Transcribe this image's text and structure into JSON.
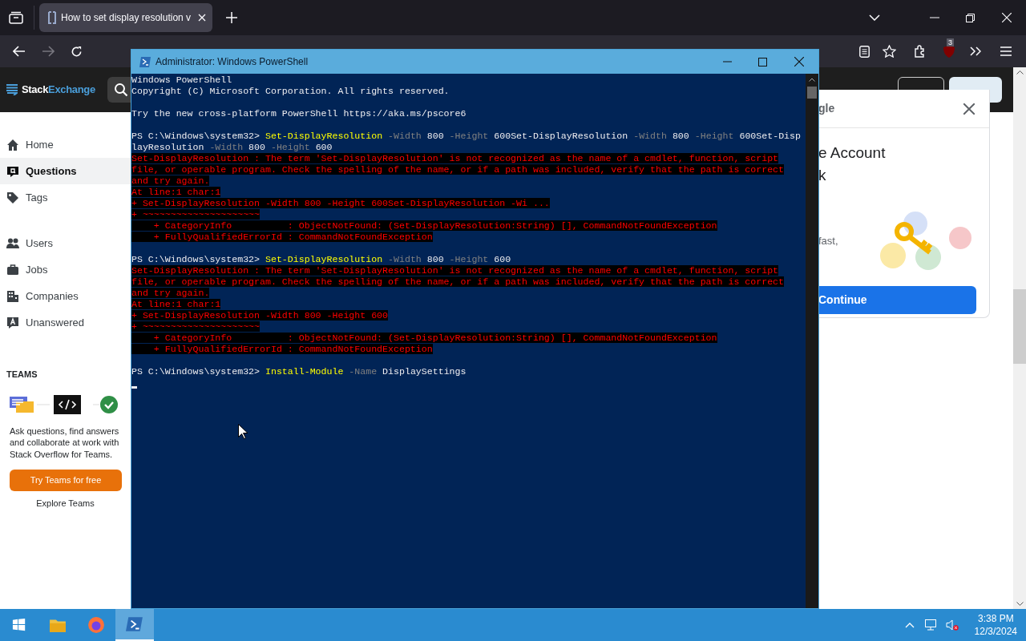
{
  "browser": {
    "tab": {
      "title": "How to set display resolution v",
      "selected": true
    },
    "extension_badge": "3"
  },
  "site": {
    "logo": {
      "first": "Stack",
      "second": "Exchange"
    },
    "nav_groups": [
      [
        {
          "label": "Home",
          "selected": false
        },
        {
          "label": "Questions",
          "selected": true
        },
        {
          "label": "Tags",
          "selected": false
        }
      ],
      [
        {
          "label": "Users",
          "selected": false
        },
        {
          "label": "Jobs",
          "selected": false
        },
        {
          "label": "Companies",
          "selected": false
        },
        {
          "label": "Unanswered",
          "selected": false
        }
      ]
    ],
    "teams": {
      "heading": "TEAMS",
      "description": "Ask questions, find answers and collaborate at work with Stack Overflow for Teams.",
      "button": "Try Teams for free",
      "link": "Explore Teams"
    }
  },
  "popup": {
    "title": "gle",
    "heading_lines": [
      "e Account",
      "k"
    ],
    "text": "fast,",
    "button": "Continue"
  },
  "powershell": {
    "title": "Administrator: Windows PowerShell",
    "lines": [
      {
        "kind": "text",
        "segments": [
          {
            "kind": "plain",
            "text": "Windows PowerShell"
          }
        ]
      },
      {
        "kind": "text",
        "segments": [
          {
            "kind": "plain",
            "text": "Copyright (C) Microsoft Corporation. All rights reserved."
          }
        ]
      },
      {
        "kind": "blank"
      },
      {
        "kind": "text",
        "segments": [
          {
            "kind": "plain",
            "text": "Try the new cross-platform PowerShell https://aka.ms/pscore6"
          }
        ]
      },
      {
        "kind": "blank"
      },
      {
        "kind": "text",
        "segments": [
          {
            "kind": "plain",
            "text": "PS C:\\Windows\\system32> "
          },
          {
            "kind": "command",
            "text": "Set-DisplayResolution"
          },
          {
            "kind": "parameter",
            "text": " -Width"
          },
          {
            "kind": "plain",
            "text": " 800"
          },
          {
            "kind": "parameter",
            "text": " -Height"
          },
          {
            "kind": "plain",
            "text": " 600Set-DisplayResolution"
          },
          {
            "kind": "parameter",
            "text": " -Width"
          },
          {
            "kind": "plain",
            "text": " 800"
          },
          {
            "kind": "parameter",
            "text": " -Height"
          },
          {
            "kind": "plain",
            "text": " 600Set-Disp"
          }
        ]
      },
      {
        "kind": "text",
        "segments": [
          {
            "kind": "plain",
            "text": "layResolution"
          },
          {
            "kind": "parameter",
            "text": " -Width"
          },
          {
            "kind": "plain",
            "text": " 800"
          },
          {
            "kind": "parameter",
            "text": " -Height"
          },
          {
            "kind": "plain",
            "text": " 600"
          }
        ]
      },
      {
        "kind": "error",
        "text": "Set-DisplayResolution : The term 'Set-DisplayResolution' is not recognized as the name of a cmdlet, function, script"
      },
      {
        "kind": "error",
        "text": "file, or operable program. Check the spelling of the name, or if a path was included, verify that the path is correct"
      },
      {
        "kind": "error",
        "text": "and try again."
      },
      {
        "kind": "error",
        "text": "At line:1 char:1"
      },
      {
        "kind": "error",
        "text": "+ Set-DisplayResolution -Width 800 -Height 600Set-DisplayResolution -Wi ..."
      },
      {
        "kind": "error",
        "text": "+ ~~~~~~~~~~~~~~~~~~~~~"
      },
      {
        "kind": "error",
        "text": "    + CategoryInfo          : ObjectNotFound: (Set-DisplayResolution:String) [], CommandNotFoundException"
      },
      {
        "kind": "error",
        "text": "    + FullyQualifiedErrorId : CommandNotFoundException"
      },
      {
        "kind": "blank"
      },
      {
        "kind": "text",
        "segments": [
          {
            "kind": "plain",
            "text": "PS C:\\Windows\\system32> "
          },
          {
            "kind": "command",
            "text": "Set-DisplayResolution"
          },
          {
            "kind": "parameter",
            "text": " -Width"
          },
          {
            "kind": "plain",
            "text": " 800"
          },
          {
            "kind": "parameter",
            "text": " -Height"
          },
          {
            "kind": "plain",
            "text": " 600"
          }
        ]
      },
      {
        "kind": "error",
        "text": "Set-DisplayResolution : The term 'Set-DisplayResolution' is not recognized as the name of a cmdlet, function, script"
      },
      {
        "kind": "error",
        "text": "file, or operable program. Check the spelling of the name, or if a path was included, verify that the path is correct"
      },
      {
        "kind": "error",
        "text": "and try again."
      },
      {
        "kind": "error",
        "text": "At line:1 char:1"
      },
      {
        "kind": "error",
        "text": "+ Set-DisplayResolution -Width 800 -Height 600"
      },
      {
        "kind": "error",
        "text": "+ ~~~~~~~~~~~~~~~~~~~~~"
      },
      {
        "kind": "error",
        "text": "    + CategoryInfo          : ObjectNotFound: (Set-DisplayResolution:String) [], CommandNotFoundException"
      },
      {
        "kind": "error",
        "text": "    + FullyQualifiedErrorId : CommandNotFoundException"
      },
      {
        "kind": "blank"
      },
      {
        "kind": "text",
        "segments": [
          {
            "kind": "plain",
            "text": "PS C:\\Windows\\system32> "
          },
          {
            "kind": "command",
            "text": "Install-Module"
          },
          {
            "kind": "parameter",
            "text": " -Name"
          },
          {
            "kind": "plain",
            "text": " DisplaySettings"
          }
        ]
      },
      {
        "kind": "cursor"
      }
    ]
  },
  "taskbar": {
    "apps": [
      {
        "selected": false
      },
      {
        "selected": false
      },
      {
        "selected": true
      }
    ],
    "time": "3:38 PM",
    "date": "12/3/2024"
  }
}
